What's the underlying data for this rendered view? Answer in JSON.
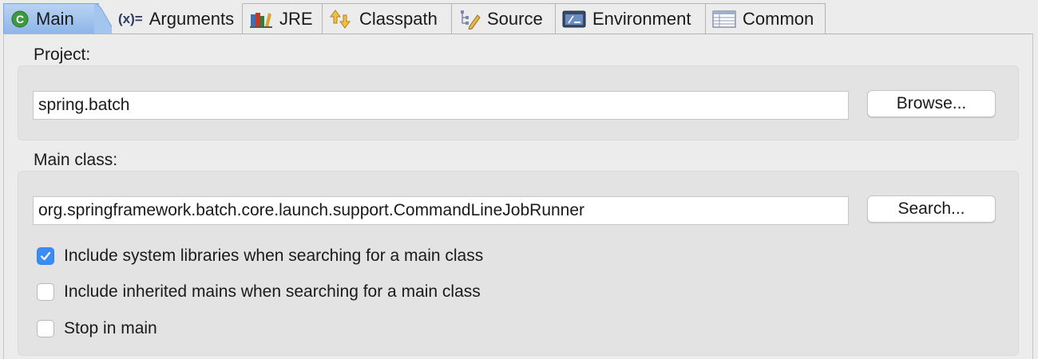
{
  "tabs": [
    {
      "label": "Main",
      "icon": "main-class-icon",
      "active": true
    },
    {
      "label": "Arguments",
      "icon": "arguments-icon",
      "icon_text": "(x)=",
      "active": false
    },
    {
      "label": "JRE",
      "icon": "jre-icon",
      "active": false
    },
    {
      "label": "Classpath",
      "icon": "classpath-icon",
      "active": false
    },
    {
      "label": "Source",
      "icon": "source-icon",
      "active": false
    },
    {
      "label": "Environment",
      "icon": "environment-icon",
      "active": false
    },
    {
      "label": "Common",
      "icon": "common-icon",
      "active": false
    }
  ],
  "project": {
    "label": "Project:",
    "value": "spring.batch",
    "browse_label": "Browse..."
  },
  "main_class": {
    "label": "Main class:",
    "value": "org.springframework.batch.core.launch.support.CommandLineJobRunner",
    "search_label": "Search..."
  },
  "options": [
    {
      "label": "Include system libraries when searching for a main class",
      "checked": true
    },
    {
      "label": "Include inherited mains when searching for a main class",
      "checked": false
    },
    {
      "label": "Stop in main",
      "checked": false
    }
  ],
  "colors": {
    "active_tab": "#8eb6e9",
    "checkbox_checked": "#3b8df5",
    "main_icon": "#3f9a3f"
  }
}
